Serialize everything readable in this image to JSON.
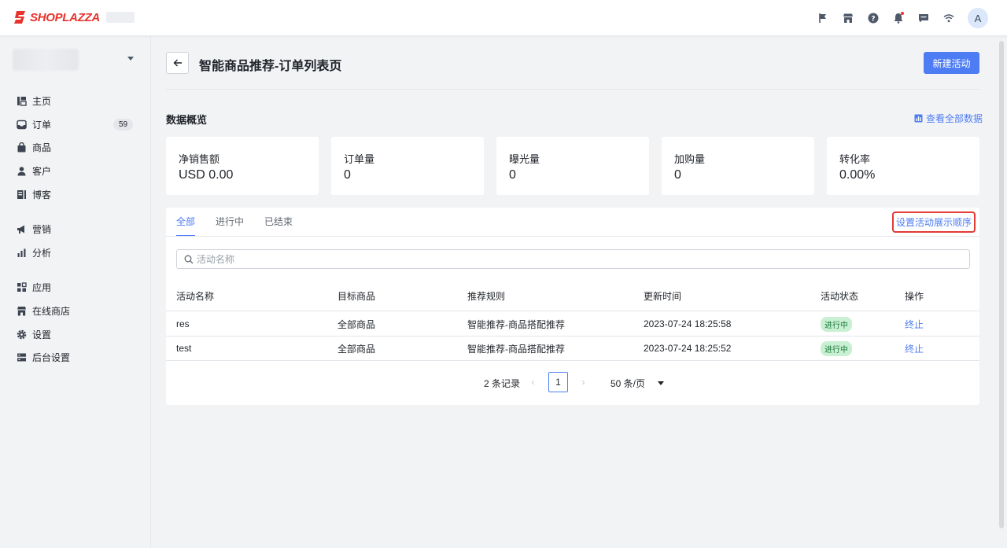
{
  "brand": {
    "logo_text": "SHOPLAZZA",
    "accent": "#e8322b",
    "primary": "#4d7cf3"
  },
  "topbar": {
    "avatar_letter": "A"
  },
  "sidebar": {
    "items": [
      {
        "label": "主页",
        "icon": "home-icon"
      },
      {
        "label": "订单",
        "icon": "inbox-icon",
        "badge": "59"
      },
      {
        "label": "商品",
        "icon": "bag-icon"
      },
      {
        "label": "客户",
        "icon": "person-icon"
      },
      {
        "label": "博客",
        "icon": "blog-icon"
      },
      {
        "label": "营销",
        "icon": "megaphone-icon"
      },
      {
        "label": "分析",
        "icon": "bar-chart-icon"
      },
      {
        "label": "应用",
        "icon": "apps-icon"
      },
      {
        "label": "在线商店",
        "icon": "storefront-icon"
      },
      {
        "label": "设置",
        "icon": "gear-icon"
      },
      {
        "label": "后台设置",
        "icon": "server-icon"
      }
    ]
  },
  "header": {
    "title": "智能商品推荐-订单列表页",
    "new_button": "新建活动"
  },
  "overview": {
    "title": "数据概览",
    "view_all": "查看全部数据",
    "stats": [
      {
        "label": "净销售额",
        "value": "USD 0.00"
      },
      {
        "label": "订单量",
        "value": "0"
      },
      {
        "label": "曝光量",
        "value": "0"
      },
      {
        "label": "加购量",
        "value": "0"
      },
      {
        "label": "转化率",
        "value": "0.00%"
      }
    ]
  },
  "tabs": {
    "items": [
      "全部",
      "进行中",
      "已结束"
    ],
    "active": 0,
    "order_link": "设置活动展示顺序"
  },
  "search": {
    "placeholder": "活动名称",
    "value": ""
  },
  "table": {
    "columns": [
      "活动名称",
      "目标商品",
      "推荐规则",
      "更新时间",
      "活动状态",
      "操作"
    ],
    "rows": [
      {
        "name": "res",
        "target": "全部商品",
        "rule": "智能推荐-商品搭配推荐",
        "updated": "2023-07-24 18:25:58",
        "status": "进行中",
        "action": "终止"
      },
      {
        "name": "test",
        "target": "全部商品",
        "rule": "智能推荐-商品搭配推荐",
        "updated": "2023-07-24 18:25:52",
        "status": "进行中",
        "action": "终止"
      }
    ]
  },
  "pagination": {
    "total": "2 条记录",
    "prev": "‹",
    "page": "1",
    "next": "›",
    "page_size": "50 条/页"
  }
}
